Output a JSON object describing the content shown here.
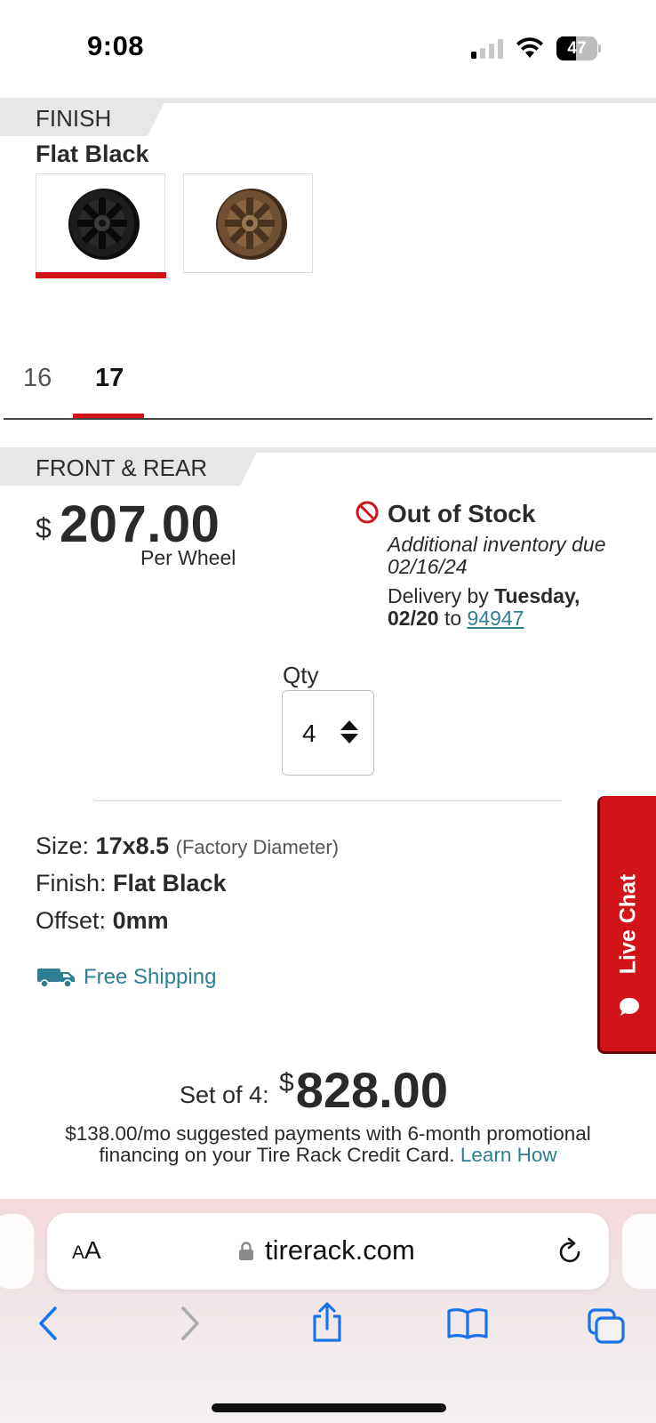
{
  "status_bar": {
    "time": "9:08",
    "battery_level": "47",
    "battery_fraction": 0.47,
    "signal_bars_active": 1
  },
  "finish": {
    "section_label": "FINISH",
    "selected_name": "Flat Black",
    "options": [
      {
        "name": "Flat Black",
        "color": "#1a1a1a",
        "selected": true
      },
      {
        "name": "Bronze",
        "color": "#6e4f32",
        "selected": false
      }
    ]
  },
  "diameter_tabs": [
    {
      "label": "16",
      "active": false
    },
    {
      "label": "17",
      "active": true
    }
  ],
  "position": {
    "section_label": "FRONT & REAR",
    "currency": "$",
    "price": "207.00",
    "price_unit": "Per Wheel"
  },
  "stock": {
    "status": "Out of Stock",
    "note": "Additional inventory due 02/16/24",
    "delivery_prefix": "Delivery by",
    "delivery_date": "Tuesday, 02/20",
    "delivery_to": "to",
    "zip": "94947"
  },
  "quantity": {
    "label": "Qty",
    "value": "4"
  },
  "specs": {
    "size_label": "Size:",
    "size_value": "17x8.5",
    "size_note": "(Factory Diameter)",
    "finish_label": "Finish:",
    "finish_value": "Flat Black",
    "offset_label": "Offset:",
    "offset_value": "0mm"
  },
  "shipping": {
    "label": "Free Shipping"
  },
  "live_chat": {
    "label": "Live Chat"
  },
  "set_total": {
    "label": "Set of 4:",
    "currency": "$",
    "price": "828.00"
  },
  "financing": {
    "text": "$138.00/mo suggested payments with 6-month promotional financing on your Tire Rack Credit Card.",
    "link": "Learn How"
  },
  "browser": {
    "text_size_big": "A",
    "text_size_small": "A",
    "url": "tirerack.com"
  },
  "colors": {
    "accent_red": "#d1131a",
    "link_teal": "#2f7f94",
    "ios_blue": "#1a73e8"
  }
}
